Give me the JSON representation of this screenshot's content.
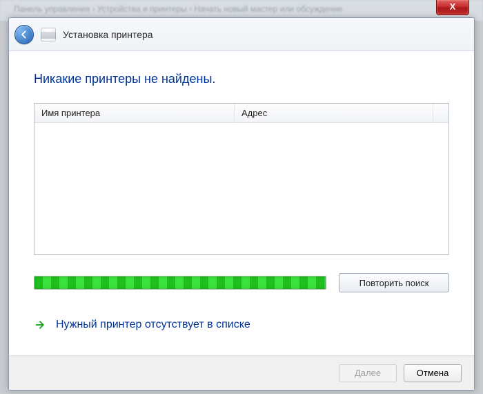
{
  "window": {
    "close_glyph": "X",
    "bg_breadcrumb": "Панель управления  ›  Устройства и принтеры  ›  Начать новый мастер или обсуждение"
  },
  "header": {
    "title": "Установка принтера"
  },
  "body": {
    "heading": "Никакие принтеры не найдены.",
    "columns": {
      "name": "Имя принтера",
      "address": "Адрес"
    },
    "search_again": "Повторить поиск",
    "not_in_list": "Нужный принтер отсутствует в списке"
  },
  "footer": {
    "next": "Далее",
    "cancel": "Отмена"
  },
  "colors": {
    "accent": "#003399",
    "progress": "#1fbf1f"
  }
}
